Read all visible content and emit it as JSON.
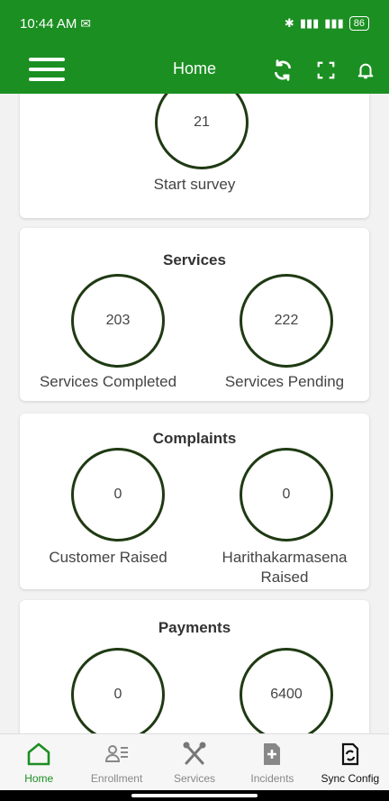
{
  "status": {
    "time": "10:44 AM",
    "battery": "86"
  },
  "appbar": {
    "title": "Home"
  },
  "survey": {
    "value": "21",
    "label": "Start survey"
  },
  "services": {
    "title": "Services",
    "completed_value": "203",
    "completed_label": "Services Completed",
    "pending_value": "222",
    "pending_label": "Services Pending"
  },
  "complaints": {
    "title": "Complaints",
    "customer_value": "0",
    "customer_label": "Customer Raised",
    "hkm_value": "0",
    "hkm_label_line1": "Harithakarmasena",
    "hkm_label_line2": "Raised"
  },
  "payments": {
    "title": "Payments",
    "left_value": "0",
    "right_value": "6400"
  },
  "nav": [
    {
      "label": "Home",
      "icon": "home-icon"
    },
    {
      "label": "Enrollment",
      "icon": "enrollment-icon"
    },
    {
      "label": "Services",
      "icon": "tools-icon"
    },
    {
      "label": "Incidents",
      "icon": "incident-icon"
    },
    {
      "label": "Sync Config",
      "icon": "sync-file-icon"
    }
  ],
  "colors": {
    "primary": "#1b8f22",
    "circle_border": "#1f3a13"
  }
}
